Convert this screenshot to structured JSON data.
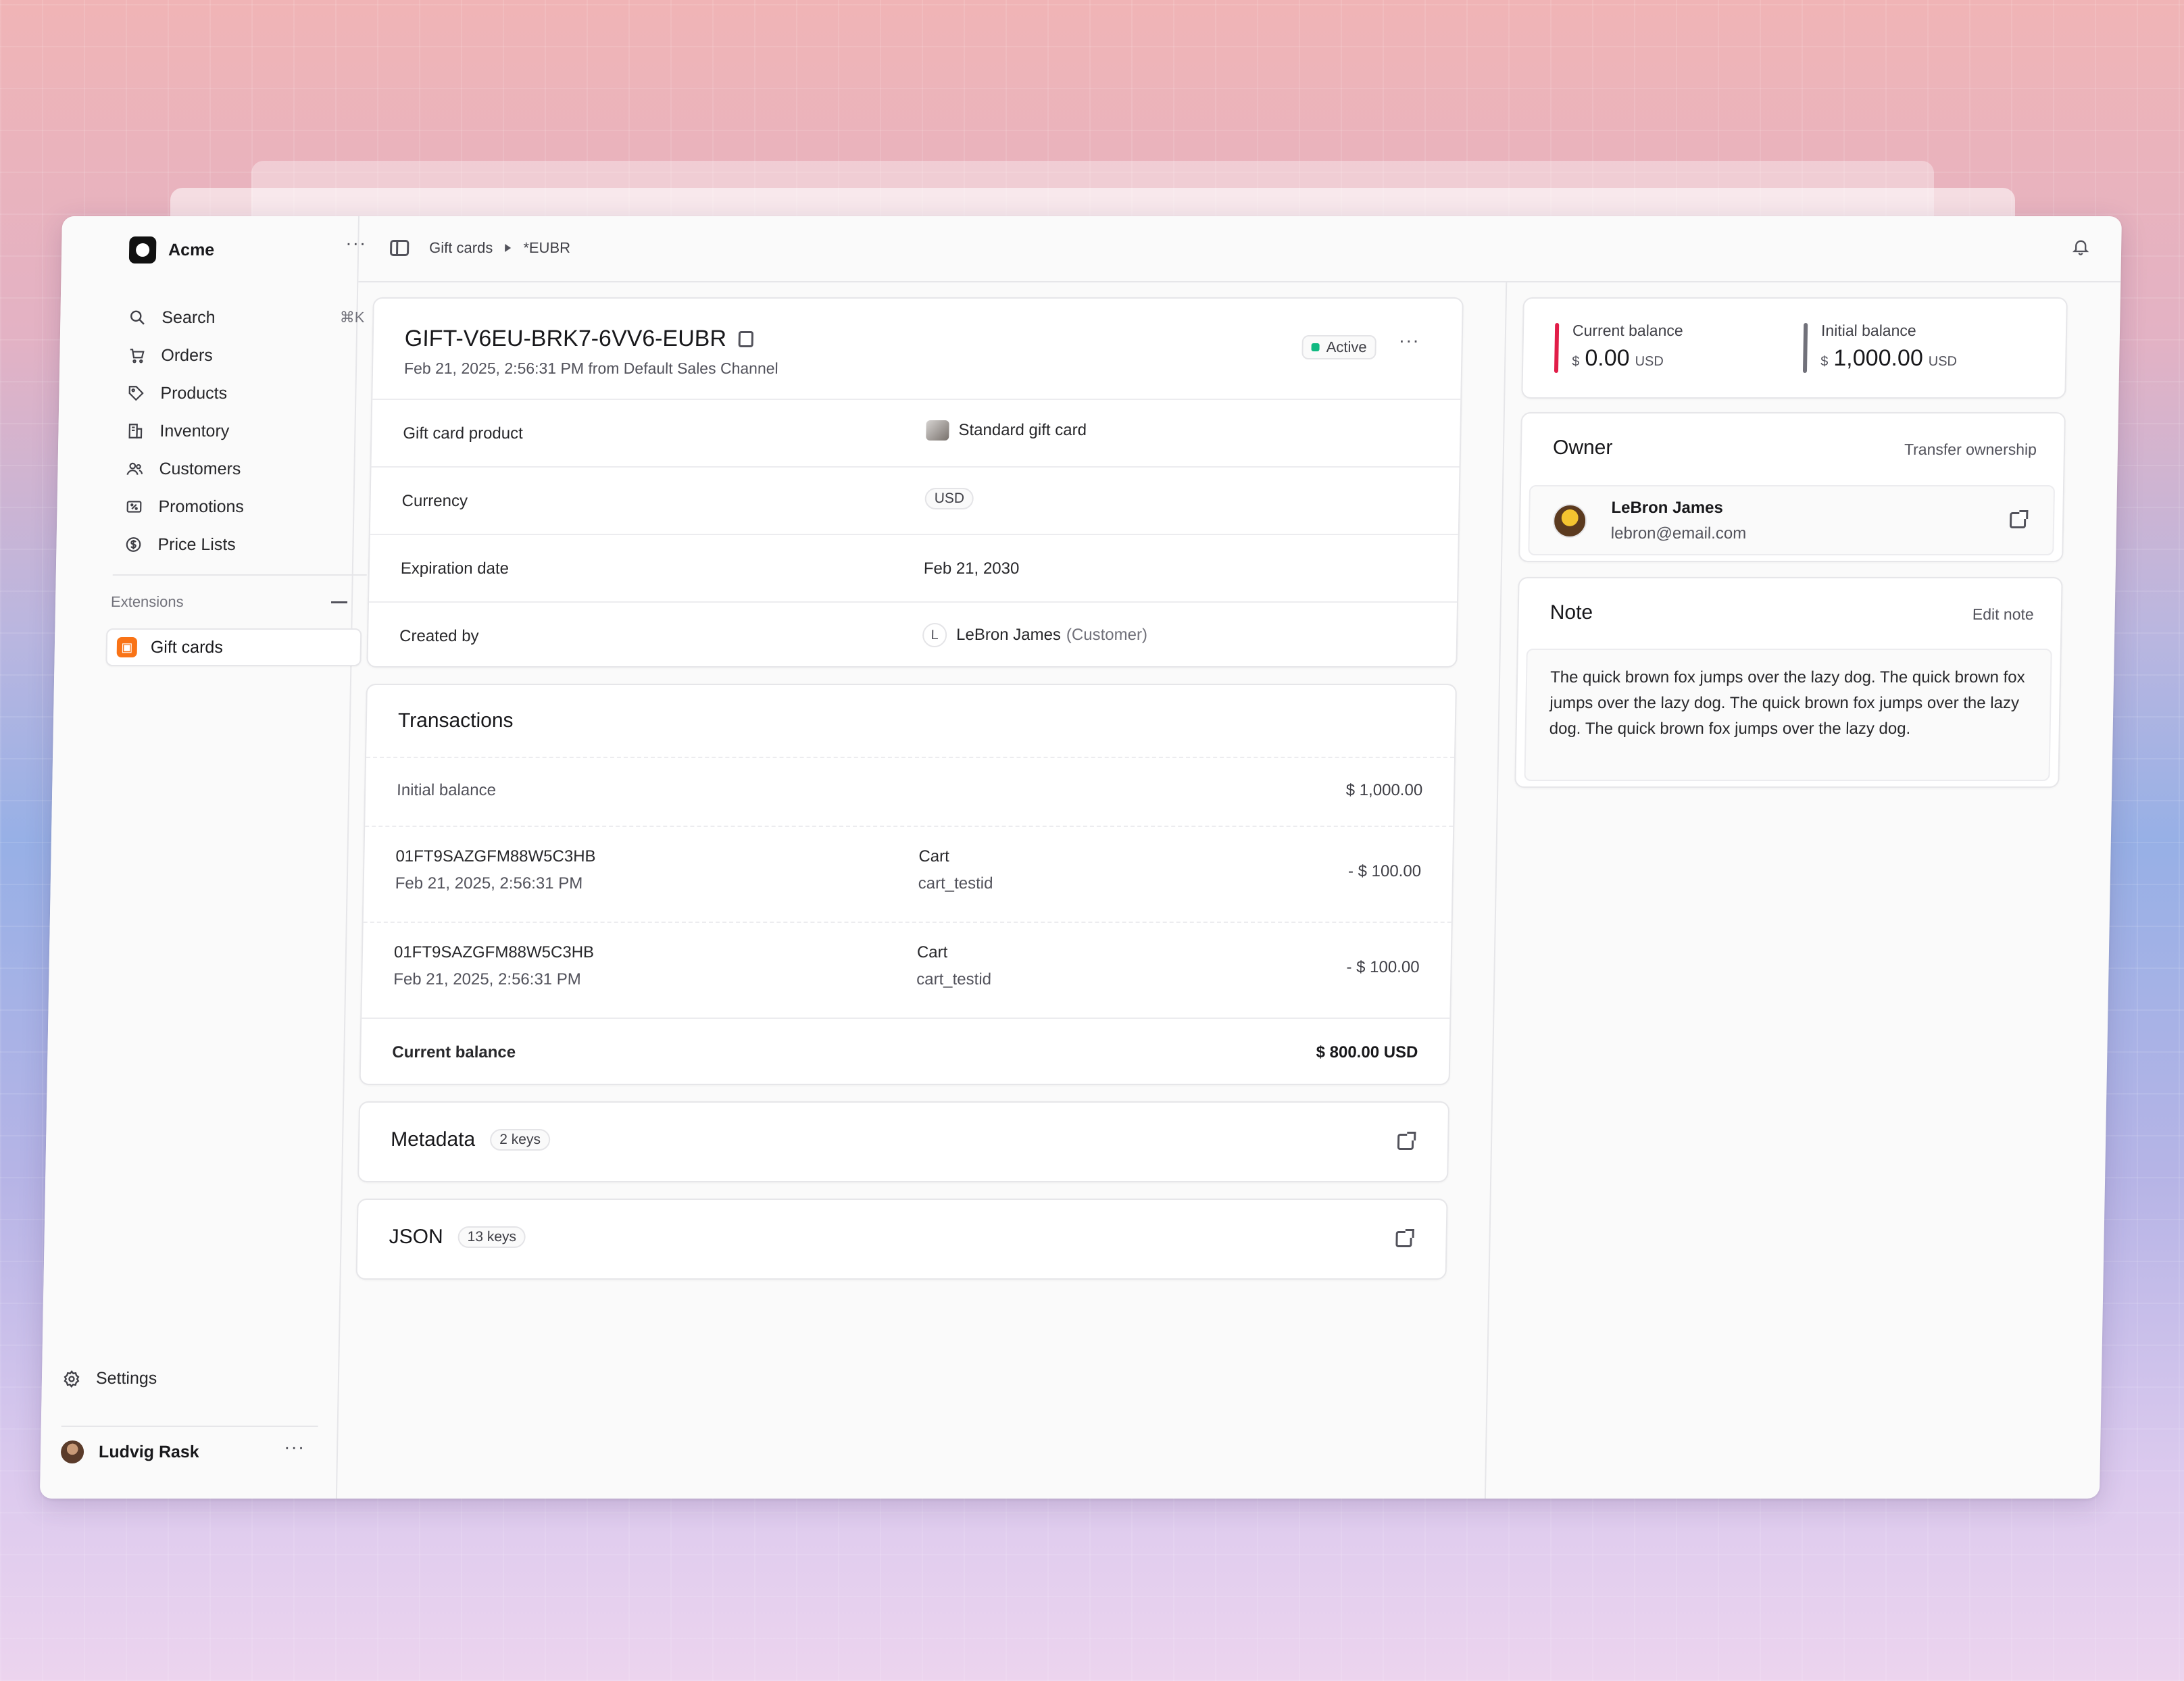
{
  "sidebar": {
    "brand": "Acme",
    "nav": [
      {
        "label": "Search",
        "icon": "search-icon",
        "shortcut": "⌘K"
      },
      {
        "label": "Orders",
        "icon": "cart-icon"
      },
      {
        "label": "Products",
        "icon": "tag-icon"
      },
      {
        "label": "Inventory",
        "icon": "building-icon"
      },
      {
        "label": "Customers",
        "icon": "users-icon"
      },
      {
        "label": "Promotions",
        "icon": "receipt-percent-icon"
      },
      {
        "label": "Price Lists",
        "icon": "currency-dollar-icon"
      }
    ],
    "extensions_label": "Extensions",
    "extension_item": "Gift cards",
    "settings": "Settings",
    "user": "Ludvig Rask"
  },
  "topbar": {
    "crumb_1": "Gift cards",
    "crumb_2": "*EUBR"
  },
  "gift_card": {
    "code": "GIFT-V6EU-BRK7-6VV6-EUBR",
    "subtitle": "Feb 21, 2025, 2:56:31 PM from Default Sales Channel",
    "status": "Active",
    "rows": {
      "product_label": "Gift card product",
      "product_value": "Standard gift card",
      "currency_label": "Currency",
      "currency_value": "USD",
      "expiration_label": "Expiration date",
      "expiration_value": "Feb 21, 2030",
      "created_label": "Created by",
      "created_initial": "L",
      "created_name": "LeBron James",
      "created_role": "(Customer)"
    }
  },
  "transactions": {
    "title": "Transactions",
    "initial_label": "Initial balance",
    "initial_value": "$ 1,000.00",
    "items": [
      {
        "id": "01FT9SAZGFM88W5C3HB",
        "date": "Feb 21, 2025, 2:56:31 PM",
        "type": "Cart",
        "ref": "cart_testid",
        "amount": "- $ 100.00"
      },
      {
        "id": "01FT9SAZGFM88W5C3HB",
        "date": "Feb 21, 2025, 2:56:31 PM",
        "type": "Cart",
        "ref": "cart_testid",
        "amount": "- $ 100.00"
      }
    ],
    "current_label": "Current balance",
    "current_value": "$ 800.00 USD"
  },
  "metadata": {
    "title": "Metadata",
    "badge": "2 keys"
  },
  "json": {
    "title": "JSON",
    "badge": "13 keys"
  },
  "balances": {
    "current_label": "Current balance",
    "current_symbol": "$",
    "current_amount": "0.00",
    "current_currency": "USD",
    "initial_label": "Initial balance",
    "initial_symbol": "$",
    "initial_amount": "1,000.00",
    "initial_currency": "USD",
    "current_color": "#e11d48",
    "initial_color": "#71717a"
  },
  "owner": {
    "title": "Owner",
    "action": "Transfer ownership",
    "name": "LeBron James",
    "email": "lebron@email.com"
  },
  "note": {
    "title": "Note",
    "action": "Edit note",
    "text": "The quick brown fox jumps over the lazy dog. The quick brown fox jumps over the lazy dog. The quick brown fox jumps over the lazy dog. The quick brown fox jumps over the lazy dog."
  }
}
